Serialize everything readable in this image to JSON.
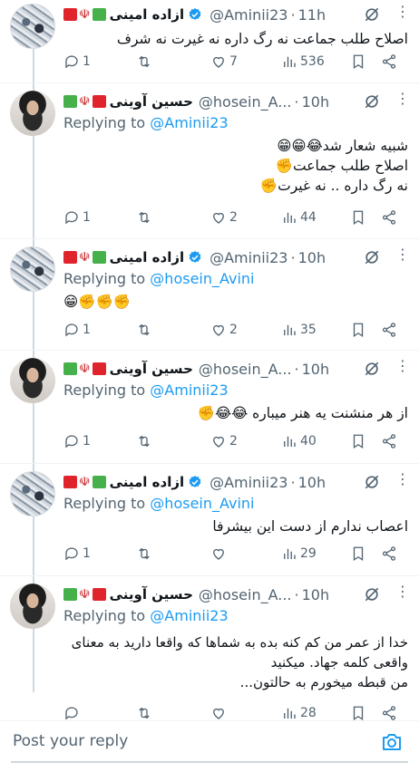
{
  "colors": {
    "accent": "#1d9bf0",
    "muted": "#536471",
    "text": "#0f1419",
    "flag_red": "#e0242b",
    "flag_green": "#46b14a"
  },
  "tweets": [
    {
      "name": "ازاده امینی",
      "handle": "@Aminii23",
      "time": "11h",
      "reply_to_label": "",
      "reply_to_user": "",
      "body": [
        "اصلاح طلب جماعت نه رگ داره نه غیرت نه شرف"
      ],
      "replies": "1",
      "retweets": "",
      "likes": "7",
      "views": "536"
    },
    {
      "name": "حسین آوینی",
      "handle": "@hosein_A...",
      "time": "10h",
      "reply_to_label": "Replying to",
      "reply_to_user": "@Aminii23",
      "body": [
        "شبیه شعار شد😂😁😁",
        "اصلاح طلب جماعت✊",
        "نه رگ داره .. نه غیرت✊"
      ],
      "replies": "1",
      "retweets": "",
      "likes": "2",
      "views": "44"
    },
    {
      "name": "ازاده امینی",
      "handle": "@Aminii23",
      "time": "10h",
      "reply_to_label": "Replying to",
      "reply_to_user": "@hosein_Avini",
      "body": [
        "😁✊✊✊"
      ],
      "replies": "1",
      "retweets": "",
      "likes": "2",
      "views": "35"
    },
    {
      "name": "حسین آوینی",
      "handle": "@hosein_A...",
      "time": "10h",
      "reply_to_label": "Replying to",
      "reply_to_user": "@Aminii23",
      "body": [
        "از هر منشنت یه هنر میباره 😂😂✊"
      ],
      "replies": "1",
      "retweets": "",
      "likes": "2",
      "views": "40"
    },
    {
      "name": "ازاده امینی",
      "handle": "@Aminii23",
      "time": "10h",
      "reply_to_label": "Replying to",
      "reply_to_user": "@hosein_Avini",
      "body": [
        "اعصاب ندارم از دست این بیشرفا"
      ],
      "replies": "1",
      "retweets": "",
      "likes": "",
      "views": "29"
    },
    {
      "name": "حسین آوینی",
      "handle": "@hosein_A...",
      "time": "10h",
      "reply_to_label": "Replying to",
      "reply_to_user": "@Aminii23",
      "body": [
        "خدا از عمر من کم کنه بده به شماها که واقعا دارید به معنای",
        "واقعی کلمه جهاد. میکنید",
        "من قبطه میخورم به حالتون..."
      ],
      "replies": "",
      "retweets": "",
      "likes": "",
      "views": "28"
    }
  ],
  "composer": {
    "placeholder": "Post your reply",
    "icon": "camera-icon"
  }
}
